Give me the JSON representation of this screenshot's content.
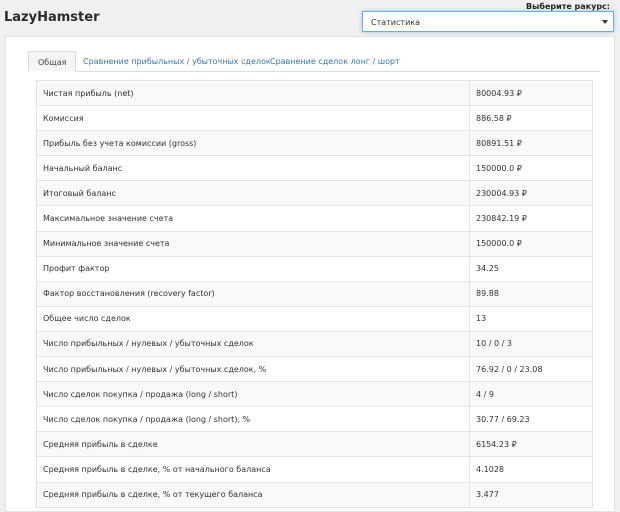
{
  "app": {
    "title": "LazyHamster"
  },
  "view_selector": {
    "label": "Выберите ракурс:",
    "selected": "Статистика"
  },
  "tabs": [
    {
      "label": "Общая",
      "active": true
    },
    {
      "label": "Сравнение прибыльных / убыточных сделок",
      "active": false
    },
    {
      "label": "Сравнение сделок лонг / шорт",
      "active": false
    }
  ],
  "stats": [
    {
      "label": "Чистая прибыль (net)",
      "value": "80004.93 ₽"
    },
    {
      "label": "Комиссия",
      "value": "886.58 ₽"
    },
    {
      "label": "Прибыль без учета комиссии (gross)",
      "value": "80891.51 ₽"
    },
    {
      "label": "Начальный баланс",
      "value": "150000.0 ₽"
    },
    {
      "label": "Итоговый баланс",
      "value": "230004.93 ₽"
    },
    {
      "label": "Максимальное значение счета",
      "value": "230842.19 ₽"
    },
    {
      "label": "Минимальное значение счета",
      "value": "150000.0 ₽"
    },
    {
      "label": "Профит фактор",
      "value": "34.25"
    },
    {
      "label": "Фактор восстановления (recovery factor)",
      "value": "89.88"
    },
    {
      "label": "Общее число сделок",
      "value": "13"
    },
    {
      "label": "Число прибыльных / нулевых / убыточных сделок",
      "value": "10 / 0 / 3"
    },
    {
      "label": "Число прибыльных / нулевых / убыточных сделок, %",
      "value": "76.92 / 0 / 23.08"
    },
    {
      "label": "Число сделок покупка / продажа (long / short)",
      "value": "4 / 9"
    },
    {
      "label": "Число сделок покупка / продажа (long / short), %",
      "value": "30.77 / 69.23"
    },
    {
      "label": "Средняя прибыль в сделке",
      "value": "6154.23 ₽"
    },
    {
      "label": "Средняя прибыль в сделке, % от начального баланса",
      "value": "4.1028"
    },
    {
      "label": "Средняя прибыль в сделке, % от текущего баланса",
      "value": "3.477"
    }
  ]
}
